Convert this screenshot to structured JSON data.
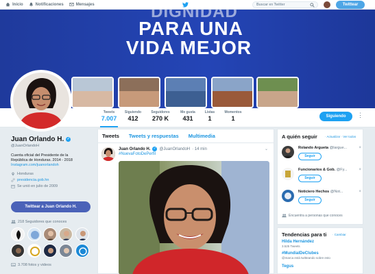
{
  "topnav": {
    "home": "Inicio",
    "notifications": "Notificaciones",
    "messages": "Mensajes",
    "search_placeholder": "Buscar en Twitter",
    "tweet_button": "Twittear"
  },
  "banner": {
    "line1": "DIGNIDAD",
    "line2": "PARA UNA",
    "line3": "VIDA MEJOR"
  },
  "stats": [
    {
      "label": "Tweets",
      "value": "7.007"
    },
    {
      "label": "Siguiendo",
      "value": "412"
    },
    {
      "label": "Seguidores",
      "value": "270 K"
    },
    {
      "label": "Me gusta",
      "value": "431"
    },
    {
      "label": "Listas",
      "value": "1"
    },
    {
      "label": "Momentos",
      "value": "1"
    }
  ],
  "follow_button": "Siguiendo",
  "profile": {
    "name": "Juan Orlando H.",
    "handle": "@JuanOrlandoH",
    "bio_line1": "Cuenta oficial del Presidente de la",
    "bio_line2": "República de Honduras. 2014 - 2018",
    "bio_line3": "Instagram.com/juanorlandoh",
    "location": "Honduras",
    "website": "presidencia.gob.hn",
    "joined": "Se unió en julio de 2009",
    "tweet_to": "Twittear a Juan Orlando H.",
    "known_followers": "218 Seguidores que conoces",
    "photos": "3.708 fotos y videos"
  },
  "timeline": {
    "tab_tweets": "Tweets",
    "tab_replies": "Tweets y respuestas",
    "tab_media": "Multimedia",
    "tweet": {
      "name": "Juan Orlando H.",
      "handle": "@JuanOrlandoH",
      "time": "· 14 min",
      "hashtag": "#NuevaFotoDePerfil"
    }
  },
  "who_to_follow": {
    "title": "A quién seguir",
    "sub": "· Actualizar · Ver todos",
    "suggestions": [
      {
        "name": "Rolando Argueta",
        "handle": "@largue...",
        "button": "Seguir"
      },
      {
        "name": "Funcionarios & Gob.",
        "handle": "@Fy...",
        "button": "Seguir"
      },
      {
        "name": "Noticiero Hechos",
        "handle": "@Not...",
        "button": "Seguir"
      }
    ],
    "find_people": "Encuentra a personas que conoces"
  },
  "trends": {
    "title": "Tendencias para ti",
    "change": "· Cambiar",
    "items": [
      {
        "name": "Hilda Hernández",
        "sub": "3.525 Tweets"
      },
      {
        "name": "#MundialDeClubes",
        "sub": "@marca está twitteando sobre esto"
      },
      {
        "name": "Tegus",
        "sub": ""
      }
    ]
  },
  "colors": {
    "accent": "#1da1f2",
    "banner_blue": "#2445b6",
    "tweet_to_button": "#4a62b8"
  }
}
